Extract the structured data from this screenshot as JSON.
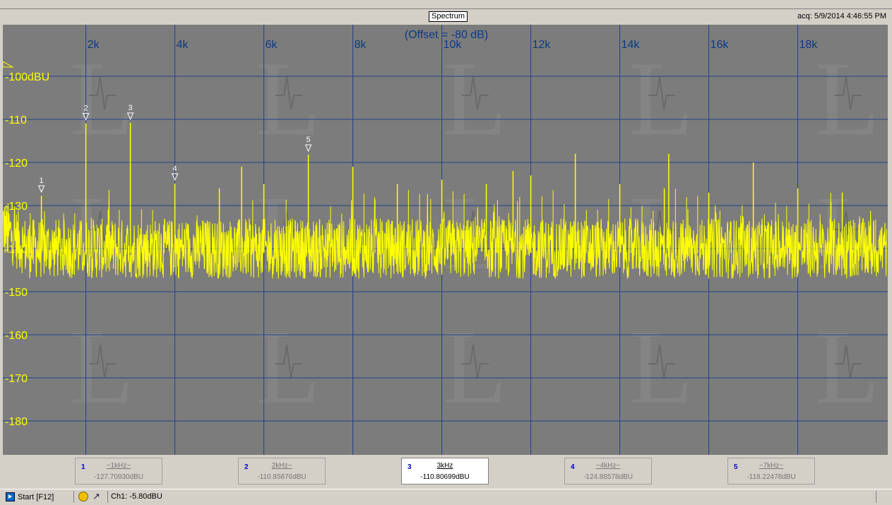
{
  "window": {
    "title": "Spectrum",
    "acq_label": "acq: 5/9/2014 4:46:55 PM"
  },
  "chart_data": {
    "type": "line",
    "title": "(Offset = -80 dB)",
    "xlabel": "",
    "ylabel": "",
    "x_unit": "Hz",
    "xlim": [
      100,
      20000
    ],
    "ylim": [
      -190,
      -90
    ],
    "x_ticks": [
      {
        "value": 2000,
        "label": "2k"
      },
      {
        "value": 4000,
        "label": "4k"
      },
      {
        "value": 6000,
        "label": "6k"
      },
      {
        "value": 8000,
        "label": "8k"
      },
      {
        "value": 10000,
        "label": "10k"
      },
      {
        "value": 12000,
        "label": "12k"
      },
      {
        "value": 14000,
        "label": "14k"
      },
      {
        "value": 16000,
        "label": "16k"
      },
      {
        "value": 18000,
        "label": "18k"
      }
    ],
    "y_ticks": [
      {
        "value": -100,
        "label": "-100dBU"
      },
      {
        "value": -110,
        "label": "-110"
      },
      {
        "value": -120,
        "label": "-120"
      },
      {
        "value": -130,
        "label": "-130"
      },
      {
        "value": -140,
        "label": "-140"
      },
      {
        "value": -150,
        "label": "-150"
      },
      {
        "value": -160,
        "label": "-160"
      },
      {
        "value": -170,
        "label": "-170"
      },
      {
        "value": -180,
        "label": "-180"
      }
    ],
    "grid": true,
    "series": [
      {
        "color": "#ffff00",
        "noise_floor": -140,
        "spurs": [
          {
            "x": 1000,
            "y": -127.7
          },
          {
            "x": 2000,
            "y": -110.9
          },
          {
            "x": 3000,
            "y": -110.8
          },
          {
            "x": 4000,
            "y": -124.9
          },
          {
            "x": 5000,
            "y": -126
          },
          {
            "x": 5500,
            "y": -121
          },
          {
            "x": 6000,
            "y": -125
          },
          {
            "x": 7000,
            "y": -118.2
          },
          {
            "x": 8000,
            "y": -121
          },
          {
            "x": 9000,
            "y": -125
          },
          {
            "x": 10000,
            "y": -124
          },
          {
            "x": 11000,
            "y": -125
          },
          {
            "x": 11600,
            "y": -122
          },
          {
            "x": 12000,
            "y": -123
          },
          {
            "x": 13000,
            "y": -118
          },
          {
            "x": 14000,
            "y": -125
          },
          {
            "x": 15000,
            "y": -126
          },
          {
            "x": 15100,
            "y": -118
          },
          {
            "x": 16000,
            "y": -127
          },
          {
            "x": 17000,
            "y": -120
          },
          {
            "x": 18000,
            "y": -126
          },
          {
            "x": 19000,
            "y": -127
          }
        ]
      }
    ],
    "markers": [
      {
        "num": "1",
        "x": 1000,
        "y": -127.7
      },
      {
        "num": "2",
        "x": 2000,
        "y": -110.9
      },
      {
        "num": "3",
        "x": 3000,
        "y": -110.8
      },
      {
        "num": "4",
        "x": 4000,
        "y": -124.9
      },
      {
        "num": "5",
        "x": 7000,
        "y": -118.2
      }
    ]
  },
  "markers_panel": [
    {
      "num": "1",
      "name": "~1kHz~",
      "value": "-127.70930dBU",
      "active": false
    },
    {
      "num": "2",
      "name": "2kHz~",
      "value": "-110.85876dBU",
      "active": false
    },
    {
      "num": "3",
      "name": "3kHz",
      "value": "-110.80699dBU",
      "active": true
    },
    {
      "num": "4",
      "name": "~4kHz~",
      "value": "-124.88578dBU",
      "active": false
    },
    {
      "num": "5",
      "name": "~7kHz~",
      "value": "-118.22478dBU",
      "active": false
    }
  ],
  "statusbar": {
    "start_label": "Start [F12]",
    "ch_readout": "Ch1: -5.80dBU"
  }
}
